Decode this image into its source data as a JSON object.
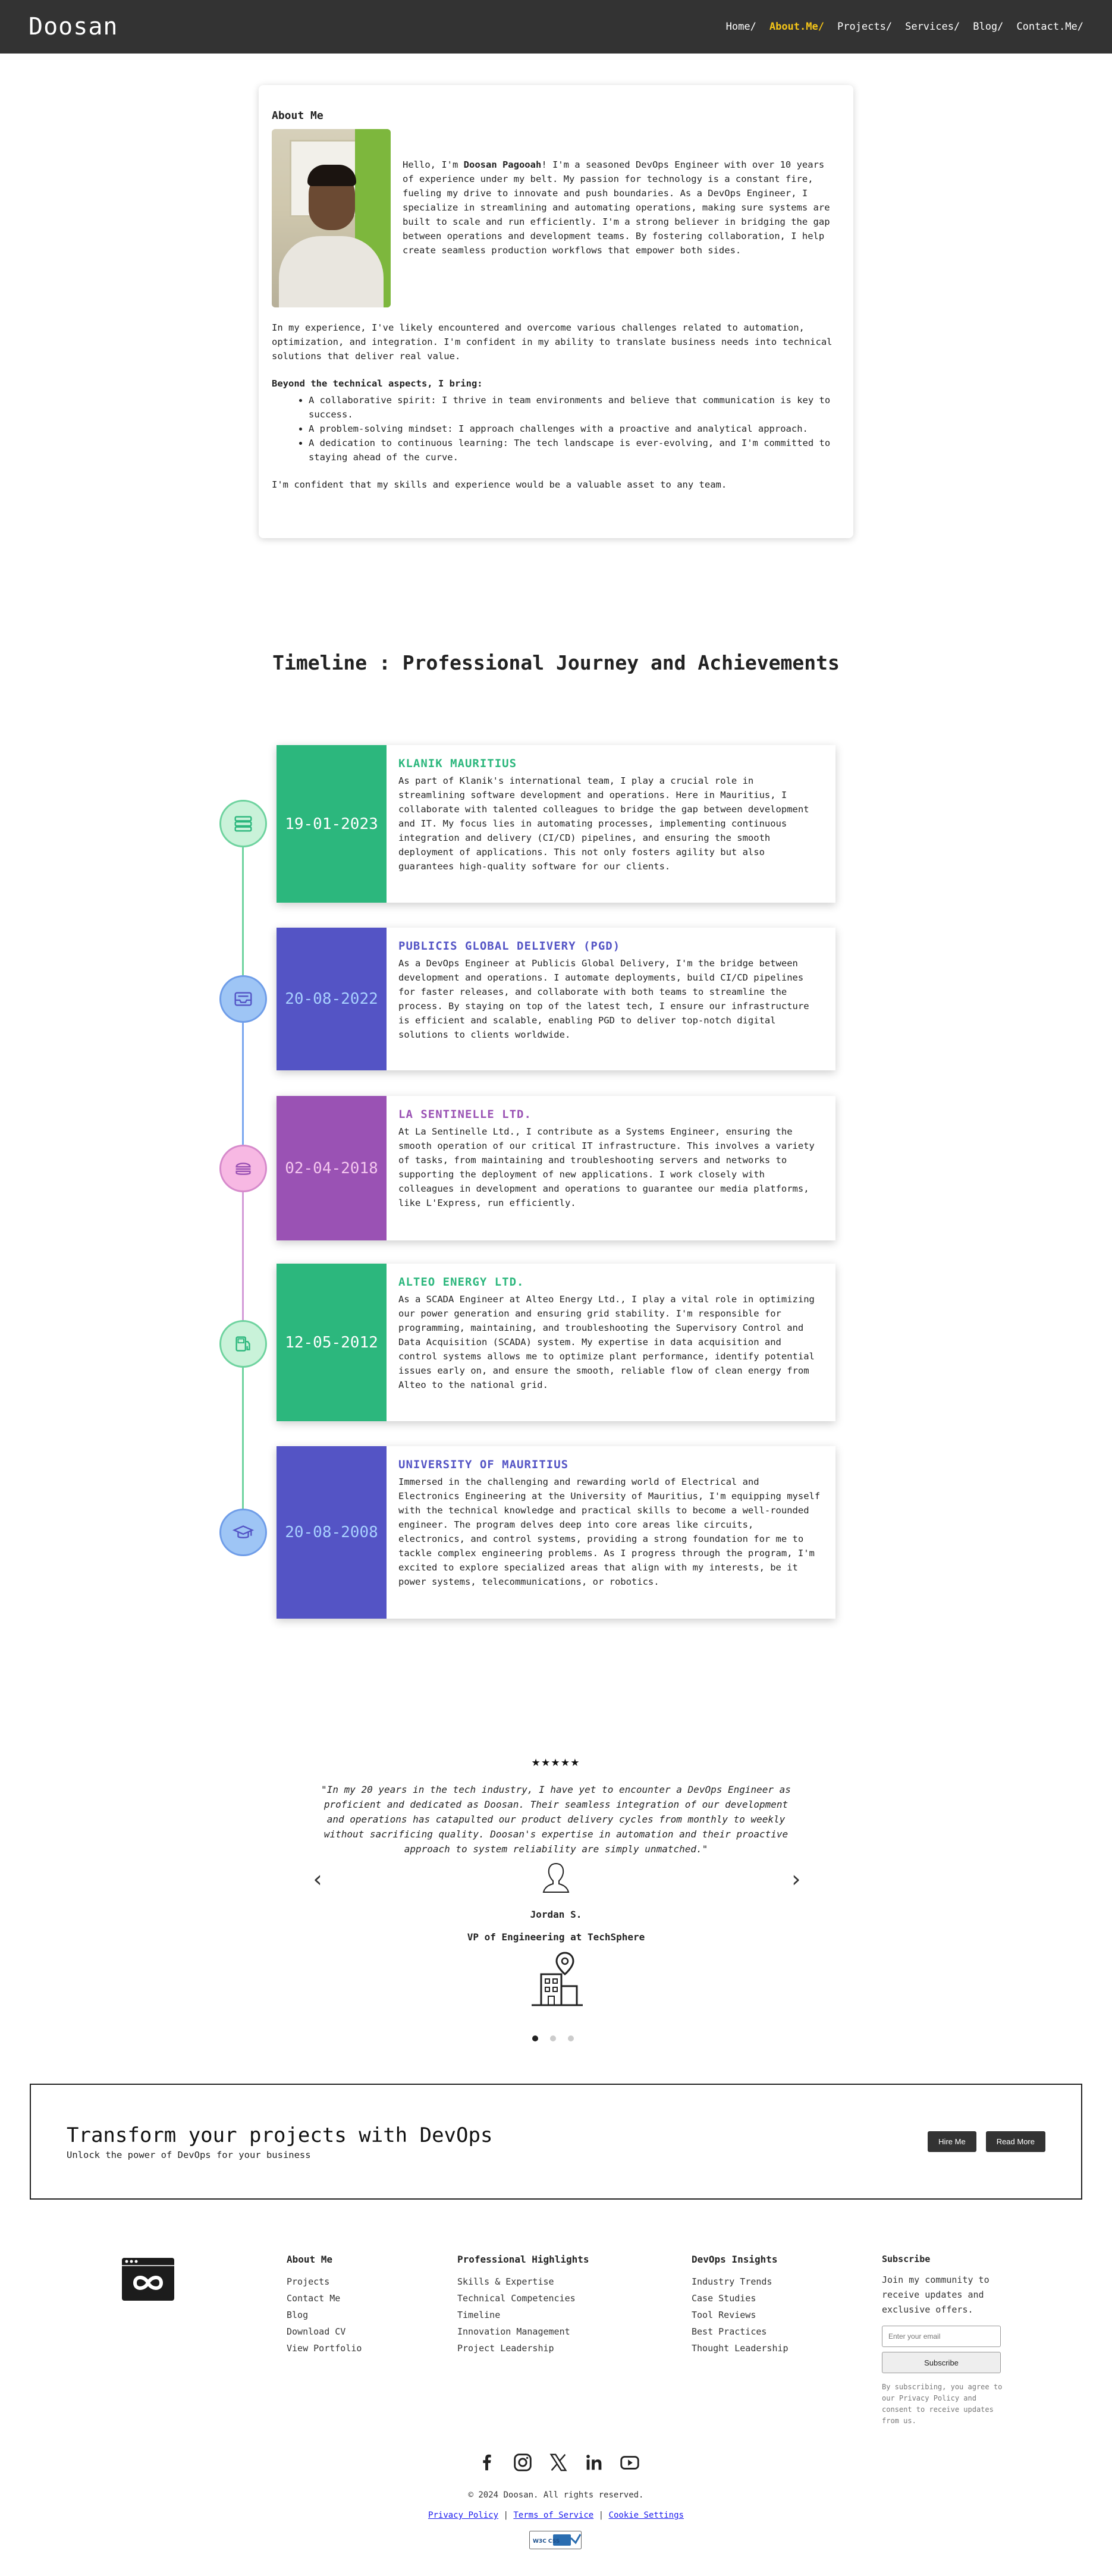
{
  "nav": {
    "brand": "Doosan",
    "links": [
      "Home/",
      "About.Me/",
      "Projects/",
      "Services/",
      "Blog/",
      "Contact.Me/"
    ],
    "active_link": "About.Me/",
    "accent_color": "#f5c518"
  },
  "about": {
    "heading": "About Me",
    "intro_prefix": "Hello, I'm ",
    "name": "Doosan Pagooah",
    "intro_rest": "! I'm a seasoned DevOps Engineer with over 10 years of experience under my belt. My passion for technology is a constant fire, fueling my drive to innovate and push boundaries. As a DevOps Engineer, I specialize in streamlining and automating operations, making sure systems are built to scale and run efficiently. I'm a strong believer in bridging the gap between operations and development teams. By fostering collaboration, I help create seamless production workflows that empower both sides.",
    "paragraph2": "In my experience, I've likely encountered and overcome various challenges related to automation, optimization, and integration. I'm confident in my ability to translate business needs into technical solutions that deliver real value.",
    "bullets_heading": "Beyond the technical aspects, I bring:",
    "bullets": [
      "A collaborative spirit: I thrive in team environments and believe that communication is key to success.",
      "A problem-solving mindset: I approach challenges with a proactive and analytical approach.",
      "A dedication to continuous learning: The tech landscape is ever-evolving, and I'm committed to staying ahead of the curve."
    ],
    "closing": "I'm confident that my skills and experience would be a valuable asset to any team."
  },
  "timeline": {
    "title": "Timeline : Professional Journey and Achievements",
    "items": [
      {
        "date": "19-01-2023",
        "company": "KLANIK MAURITIUS",
        "color": "#2cb77d",
        "icon_bg": "#c9f2d9",
        "icon": "stack-icon",
        "text": "As part of Klanik's international team, I play a crucial role in streamlining software development and operations. Here in Mauritius, I collaborate with talented colleagues to bridge the gap between development and IT. My focus lies in automating processes, implementing continuous integration and delivery (CI/CD) pipelines, and ensuring the smooth deployment of applications. This not only fosters agility but also guarantees high-quality software for our clients."
      },
      {
        "date": "20-08-2022",
        "company": "PUBLICIS GLOBAL DELIVERY (PGD)",
        "color": "#5454c5",
        "icon_bg": "#9ec5f5",
        "icon": "inbox-icon",
        "text": "As a DevOps Engineer at Publicis Global Delivery, I'm the bridge between development and operations. I automate deployments, build CI/CD pipelines for faster releases, and collaborate with both teams to streamline the process. By staying on top of the latest tech, I ensure our infrastructure is efficient and scalable, enabling PGD to deliver top-notch digital solutions to clients worldwide."
      },
      {
        "date": "02-04-2018",
        "company": "LA SENTINELLE LTD.",
        "color": "#9a52b4",
        "icon_bg": "#f7b8e3",
        "icon": "burger-icon",
        "text": "At La Sentinelle Ltd., I contribute as a Systems Engineer, ensuring the smooth operation of our critical IT infrastructure. This involves a variety of tasks, from maintaining and troubleshooting servers and networks to supporting the deployment of new applications. I work closely with colleagues in development and operations to guarantee our media platforms, like L'Express, run efficiently."
      },
      {
        "date": "12-05-2012",
        "company": "ALTEO ENERGY LTD.",
        "color": "#2cb77d",
        "icon_bg": "#c9f2d9",
        "icon": "fuel-icon",
        "text": "As a SCADA Engineer at Alteo Energy Ltd., I play a vital role in optimizing our power generation and ensuring grid stability. I'm responsible for programming, maintaining, and troubleshooting the Supervisory Control and Data Acquisition (SCADA) system. My expertise in data acquisition and control systems allows me to optimize plant performance, identify potential issues early on, and ensure the smooth, reliable flow of clean energy from Alteo to the national grid."
      },
      {
        "date": "20-08-2008",
        "company": "UNIVERSITY OF MAURITIUS",
        "color": "#5454c5",
        "icon_bg": "#9ec5f5",
        "icon": "graduation-cap-icon",
        "text": "Immersed in the challenging and rewarding world of Electrical and Electronics Engineering at the University of Mauritius, I'm equipping myself with the technical knowledge and practical skills to become a well-rounded engineer. The program delves deep into core areas like circuits, electronics, and control systems, providing a strong foundation for me to tackle complex engineering problems. As I progress through the program, I'm excited to explore specialized areas that align with my interests, be it power systems, telecommunications, or robotics."
      }
    ]
  },
  "testimonial": {
    "stars": "★★★★★",
    "rating": 5,
    "quote": "\"In my 20 years in the tech industry, I have yet to encounter a DevOps Engineer as proficient and dedicated as Doosan. Their seamless integration of our development and operations has catapulted our product delivery cycles from monthly to weekly without sacrificing quality. Doosan's expertise in automation and their proactive approach to system reliability are simply unmatched.\"",
    "name": "Jordan S.",
    "role": "VP of Engineering at TechSphere",
    "prev_arrow": "‹",
    "next_arrow": "›",
    "slides": 3,
    "active_slide": 1
  },
  "cta": {
    "title": "Transform your projects with DevOps",
    "subtitle": "Unlock the power of DevOps for your business",
    "hire_label": "Hire Me",
    "read_label": "Read More"
  },
  "footer": {
    "columns": [
      {
        "heading": "About Me",
        "links": [
          "Projects",
          "Contact Me",
          "Blog",
          "Download CV",
          "View Portfolio"
        ]
      },
      {
        "heading": "Professional Highlights",
        "links": [
          "Skills & Expertise",
          "Technical Competencies",
          "Timeline",
          "Innovation Management",
          "Project Leadership"
        ]
      },
      {
        "heading": "DevOps Insights",
        "links": [
          "Industry Trends",
          "Case Studies",
          "Tool Reviews",
          "Best Practices",
          "Thought Leadership"
        ]
      }
    ],
    "subscribe": {
      "heading": "Subscribe",
      "text": "Join my community to receive updates and exclusive offers.",
      "placeholder": "Enter your email",
      "button": "Subscribe",
      "fine_print": "By subscribing, you agree to our Privacy Policy and consent to receive updates from us."
    },
    "socials": [
      "facebook-icon",
      "instagram-icon",
      "x-icon",
      "linkedin-icon",
      "youtube-icon"
    ],
    "copyright": "© 2024 Doosan. All rights reserved.",
    "legal": [
      "Privacy Policy",
      "Terms of Service",
      "Cookie Settings"
    ],
    "legal_separator": "|",
    "badge": "W3C CSS"
  }
}
